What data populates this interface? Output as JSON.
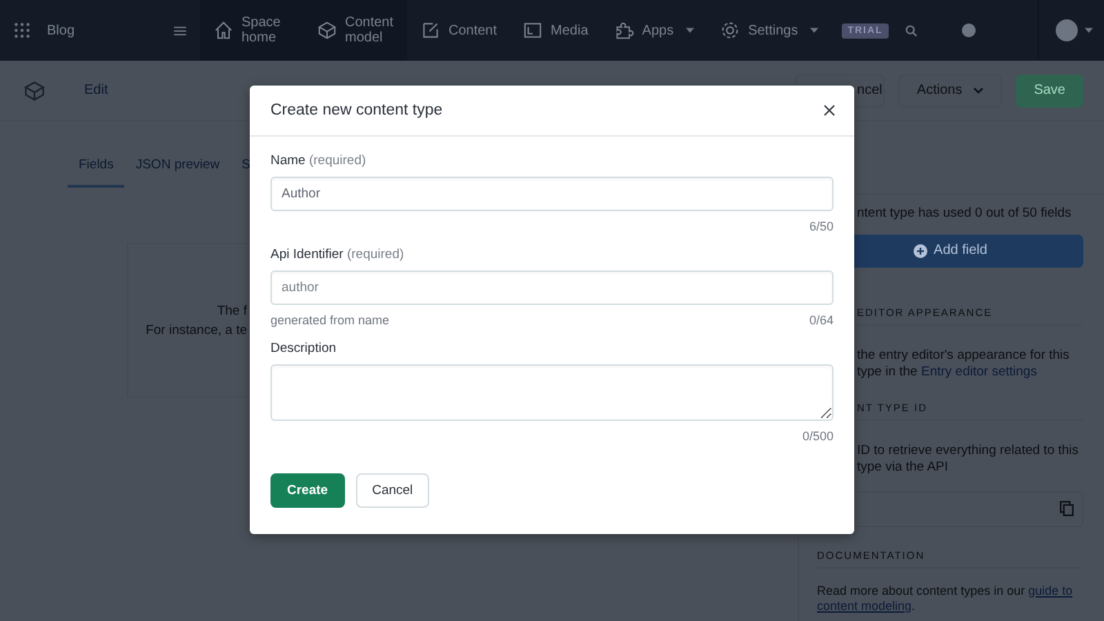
{
  "nav": {
    "space": "Blog",
    "items": [
      {
        "label": "Space home",
        "kind": "home",
        "dropdown": false
      },
      {
        "label": "Content model",
        "kind": "model",
        "dropdown": false
      },
      {
        "label": "Content",
        "kind": "content",
        "dropdown": false
      },
      {
        "label": "Media",
        "kind": "media",
        "dropdown": false
      },
      {
        "label": "Apps",
        "kind": "apps",
        "dropdown": true
      },
      {
        "label": "Settings",
        "kind": "settings",
        "dropdown": true
      }
    ],
    "badge": "TRIAL"
  },
  "toolbar": {
    "link": "Edit",
    "buttons": [
      {
        "label": "ncel",
        "kind": "secondary",
        "caret": false
      },
      {
        "label": "Actions",
        "kind": "secondary",
        "caret": true
      },
      {
        "label": "Save",
        "kind": "primary",
        "caret": false
      }
    ]
  },
  "tabs": [
    {
      "label": "Fields",
      "selected": true
    },
    {
      "label": "JSON preview",
      "selected": false
    },
    {
      "label": "S",
      "selected": false
    }
  ],
  "empty_state": {
    "lines": [
      "The f",
      "For instance, a te"
    ]
  },
  "side_panel": {
    "usage": "ntent type has used 0 out of 50 fields",
    "add_button": "Add field",
    "sections": [
      {
        "heading": "EDITOR APPEARANCE",
        "lines": [
          "the entry editor's appearance for this",
          "type in the **Entry editor settings**"
        ],
        "kind": "text"
      },
      {
        "heading": "NT TYPE ID",
        "lines": [
          "ID to retrieve everything related to this",
          "type via the API"
        ],
        "kind": "id"
      }
    ],
    "documentation": {
      "heading": "DOCUMENTATION",
      "text": "Read more about content types in our",
      "links": [
        "guide to",
        "content modeling"
      ],
      "end": "."
    }
  },
  "dialog": {
    "title": "Create new content type",
    "fields": [
      {
        "label": "Name",
        "hint": "(required)",
        "kind": "input",
        "value": "Author",
        "counter": "6/50"
      },
      {
        "label": "Api Identifier",
        "hint": "(required)",
        "kind": "input",
        "placeholder": "author",
        "helper": "generated from name",
        "counter": "0/64"
      },
      {
        "label": "Description",
        "kind": "textarea",
        "counter": "0/500"
      }
    ],
    "buttons": [
      {
        "label": "Create",
        "kind": "primary"
      },
      {
        "label": "Cancel",
        "kind": "secondary"
      }
    ]
  }
}
